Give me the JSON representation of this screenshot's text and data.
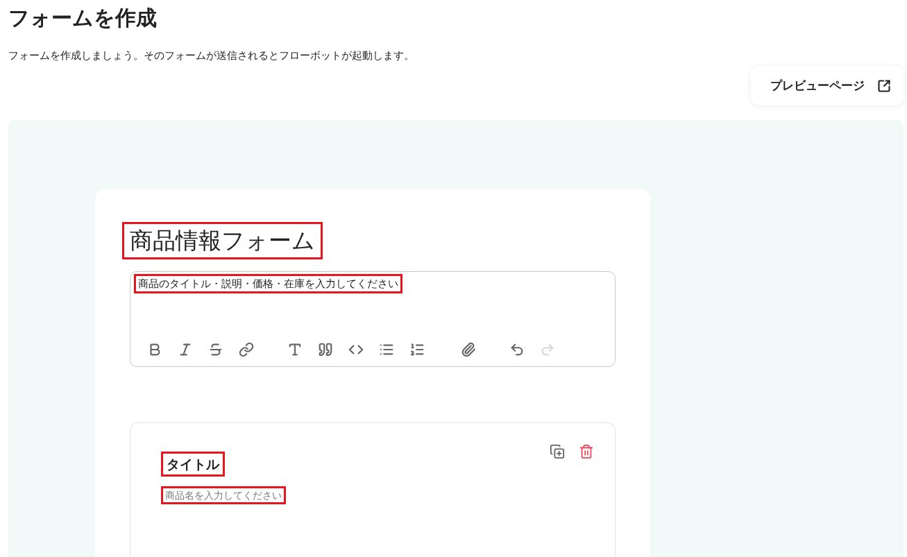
{
  "page": {
    "title": "フォームを作成",
    "description": "フォームを作成しましょう。そのフォームが送信されるとフローボットが起動します。"
  },
  "preview_button": {
    "label": "プレビューページ"
  },
  "form": {
    "title": {
      "text": "商品情報フォーム",
      "highlighted": true
    },
    "description_editor": {
      "text": "商品のタイトル・説明・価格・在庫を入力してください",
      "highlighted": true,
      "toolbar": [
        {
          "kind": "bold",
          "disabled": false
        },
        {
          "kind": "italic",
          "disabled": false
        },
        {
          "kind": "strike",
          "disabled": false
        },
        {
          "kind": "link",
          "disabled": false
        },
        {
          "kind": "heading",
          "disabled": false
        },
        {
          "kind": "quote",
          "disabled": false
        },
        {
          "kind": "code",
          "disabled": false
        },
        {
          "kind": "bullets",
          "disabled": false
        },
        {
          "kind": "numbers",
          "disabled": false
        },
        {
          "kind": "attach",
          "disabled": false
        },
        {
          "kind": "undo",
          "disabled": false
        },
        {
          "kind": "redo",
          "disabled": true
        }
      ]
    },
    "questions": [
      {
        "label": {
          "text": "タイトル",
          "highlighted": true
        },
        "hint": {
          "text": "商品名を入力してください",
          "highlighted": true
        }
      }
    ]
  }
}
